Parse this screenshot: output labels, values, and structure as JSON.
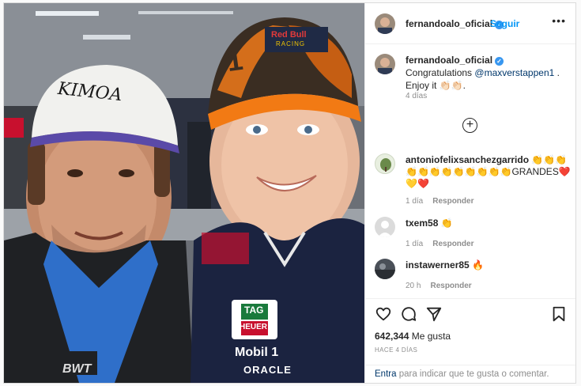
{
  "post": {
    "author": "fernandoalo_oficial",
    "follow_label": "Seguir",
    "more_label": "•••",
    "photo_alt": "Selfie photo"
  },
  "caption": {
    "author": "fernandoalo_oficial",
    "text_before": "Congratulations ",
    "mention": "@maxverstappen1",
    "text_after": " .",
    "line2": "Enjoy it 👏🏻👏🏻.",
    "time": "4 días"
  },
  "load_more_label": "+",
  "comments": [
    {
      "author": "antoniofelixsanchezgarrido",
      "text": "👏👏👏👏👏👏👏👏👏👏👏👏GRANDES❤️💛❤️",
      "time": "1 día",
      "reply": "Responder"
    },
    {
      "author": "txem58",
      "text": "👏",
      "time": "1 día",
      "reply": "Responder"
    },
    {
      "author": "instawerner85",
      "text": "🔥",
      "time": "20 h",
      "reply": "Responder"
    }
  ],
  "likes": {
    "count": "642,344",
    "label": " Me gusta"
  },
  "time_ago": "HACE 4 DÍAS",
  "footer": {
    "login": "Entra",
    "rest": " para indicar que te gusta o comentar."
  },
  "photo_text": {
    "cap_left": "KIMOA",
    "cap_right_brand": "Red Bull",
    "cap_right_sub": "RACING",
    "cap_number": "1",
    "sponsor1": "TAG",
    "sponsor1b": "HEUER",
    "sponsor2": "Mobil 1",
    "sponsor3": "ORACLE",
    "jacket_left": "BWT"
  },
  "colors": {
    "accent": "#0095f6",
    "verified": "#3897f0",
    "link": "#00376b",
    "muted": "#8e8e8e"
  }
}
